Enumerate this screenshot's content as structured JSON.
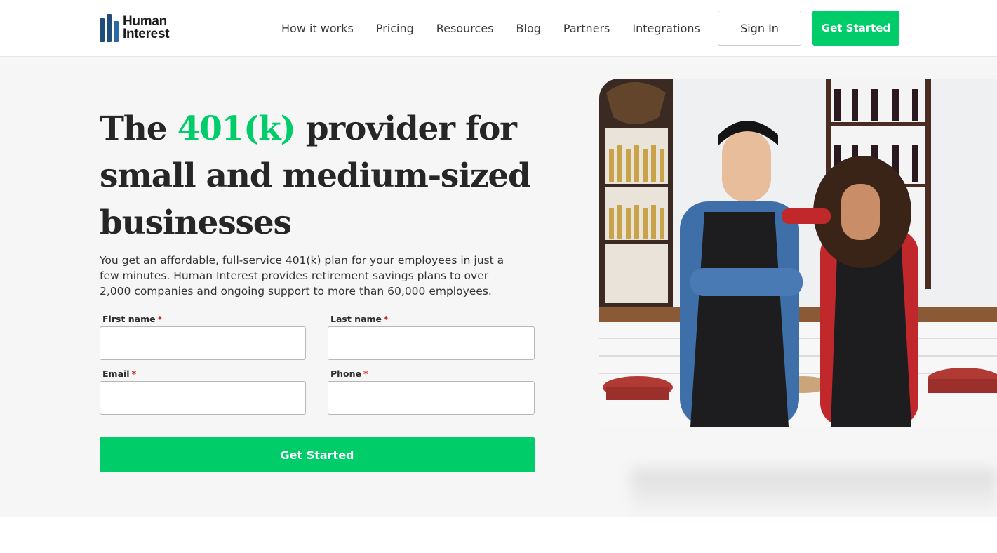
{
  "header": {
    "brand_line1": "Human",
    "brand_line2": "Interest",
    "nav": [
      {
        "label": "How it works"
      },
      {
        "label": "Pricing"
      },
      {
        "label": "Resources"
      },
      {
        "label": "Blog"
      },
      {
        "label": "Partners"
      },
      {
        "label": "Integrations"
      }
    ],
    "sign_in_label": "Sign In",
    "cta_label": "Get Started"
  },
  "hero": {
    "headline_prefix": "The ",
    "headline_accent": "401(k)",
    "headline_suffix": " provider for small and medium-sized businesses",
    "subcopy": "You get an affordable, full-service 401(k) plan for your employees in just a few minutes. Human Interest provides retirement savings plans to over 2,000 companies and ongoing support to more than 60,000 employees.",
    "form": {
      "first_name_label": "First name",
      "last_name_label": "Last name",
      "email_label": "Email",
      "phone_label": "Phone",
      "required_marker": "*",
      "first_name_value": "",
      "last_name_value": "",
      "email_value": "",
      "phone_value": "",
      "submit_label": "Get Started"
    }
  },
  "colors": {
    "accent": "#00cc6a",
    "brand_navy": "#1f4e7a",
    "hero_bg": "#f6f6f6",
    "required": "#d21f1f"
  },
  "icons": [
    "human-interest-logo-icon"
  ]
}
